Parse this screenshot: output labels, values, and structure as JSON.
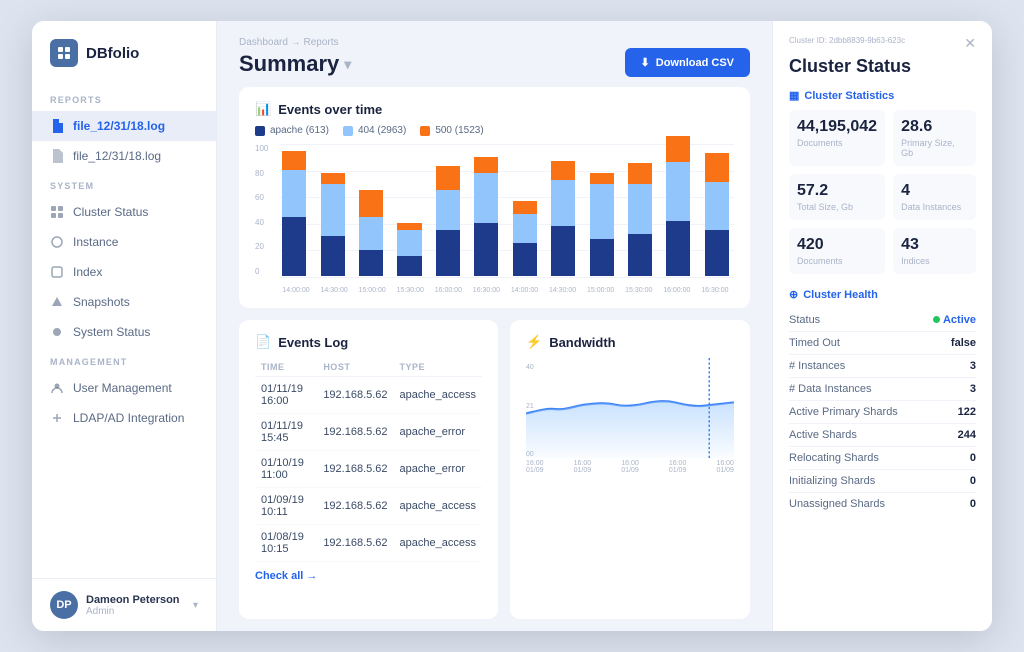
{
  "app": {
    "name": "DBfolio"
  },
  "sidebar": {
    "reports_label": "REPORTS",
    "system_label": "SYSTEM",
    "management_label": "MANAGEMENT",
    "items_reports": [
      {
        "label": "file_12/31/18.log",
        "active": true
      },
      {
        "label": "file_12/31/18.log",
        "active": false
      }
    ],
    "items_system": [
      {
        "label": "Cluster Status"
      },
      {
        "label": "Instance"
      },
      {
        "label": "Index"
      },
      {
        "label": "Snapshots"
      },
      {
        "label": "System Status"
      }
    ],
    "items_management": [
      {
        "label": "User Management"
      },
      {
        "label": "LDAP/AD Integration"
      }
    ],
    "user": {
      "name": "Dameon Peterson",
      "role": "Admin",
      "initials": "DP"
    }
  },
  "header": {
    "breadcrumb": "Dashboard → Reports",
    "title": "Summary",
    "title_arrow": "▾",
    "download_btn": "Download CSV"
  },
  "events_chart": {
    "title": "Events over time",
    "legend": [
      {
        "label": "apache (613)",
        "color": "#1e3a8a"
      },
      {
        "label": "404 (2963)",
        "color": "#93c5fd"
      },
      {
        "label": "500 (1523)",
        "color": "#f97316"
      }
    ],
    "y_labels": [
      "100",
      "80",
      "60",
      "40",
      "20",
      "0"
    ],
    "bars": [
      {
        "apache": 45,
        "err404": 35,
        "err500": 15
      },
      {
        "apache": 30,
        "err404": 40,
        "err500": 8
      },
      {
        "apache": 20,
        "err404": 25,
        "err500": 20
      },
      {
        "apache": 15,
        "err404": 20,
        "err500": 5
      },
      {
        "apache": 35,
        "err404": 30,
        "err500": 18
      },
      {
        "apache": 40,
        "err404": 38,
        "err500": 12
      },
      {
        "apache": 25,
        "err404": 22,
        "err500": 10
      },
      {
        "apache": 38,
        "err404": 35,
        "err500": 14
      },
      {
        "apache": 28,
        "err404": 42,
        "err500": 8
      },
      {
        "apache": 32,
        "err404": 38,
        "err500": 16
      },
      {
        "apache": 42,
        "err404": 44,
        "err500": 20
      },
      {
        "apache": 35,
        "err404": 36,
        "err500": 22
      }
    ],
    "x_labels": [
      "14:00:00",
      "14:30:00",
      "15:00:00",
      "15:30:00",
      "16:00:00",
      "16:30:00",
      "14:00:00",
      "14:30:00",
      "15:00:00",
      "15:30:00",
      "16:00:00",
      "16:30:00"
    ]
  },
  "events_log": {
    "title": "Events Log",
    "columns": [
      "TIME",
      "HOST",
      "TYPE"
    ],
    "rows": [
      {
        "time": "01/11/19 16:00",
        "host": "192.168.5.62",
        "type": "apache_access"
      },
      {
        "time": "01/11/19 15:45",
        "host": "192.168.5.62",
        "type": "apache_error"
      },
      {
        "time": "01/10/19 11:00",
        "host": "192.168.5.62",
        "type": "apache_error"
      },
      {
        "time": "01/09/19 10:11",
        "host": "192.168.5.62",
        "type": "apache_access"
      },
      {
        "time": "01/08/19 10:15",
        "host": "192.168.5.62",
        "type": "apache_access"
      }
    ],
    "check_all": "Check all →"
  },
  "bandwidth": {
    "title": "Bandwidth",
    "x_labels": [
      "16:00 01/09",
      "16:00 01/09",
      "16:00 01/09",
      "16:00 01/09",
      "16:00 01/09"
    ],
    "y_labels": [
      "40",
      "21",
      "00"
    ]
  },
  "cluster_status": {
    "cluster_id": "Cluster ID: 2dbb8839-9b63-623c",
    "title": "Cluster Status",
    "stats_title": "Cluster Statistics",
    "stats": [
      {
        "value": "44,195,042",
        "label": "Documents"
      },
      {
        "value": "28.6",
        "label": "Primary Size, Gb"
      },
      {
        "value": "57.2",
        "label": "Total Size, Gb"
      },
      {
        "value": "4",
        "label": "Data Instances"
      },
      {
        "value": "420",
        "label": "Documents"
      },
      {
        "value": "43",
        "label": "Indices"
      }
    ],
    "health_title": "Cluster Health",
    "health_rows": [
      {
        "label": "Status",
        "value": "Active",
        "type": "active"
      },
      {
        "label": "Timed Out",
        "value": "false"
      },
      {
        "label": "# Instances",
        "value": "3"
      },
      {
        "label": "# Data Instances",
        "value": "3"
      },
      {
        "label": "Active Primary Shards",
        "value": "122"
      },
      {
        "label": "Active Shards",
        "value": "244"
      },
      {
        "label": "Relocating Shards",
        "value": "0"
      },
      {
        "label": "Initializing Shards",
        "value": "0"
      },
      {
        "label": "Unassigned Shards",
        "value": "0"
      }
    ]
  }
}
